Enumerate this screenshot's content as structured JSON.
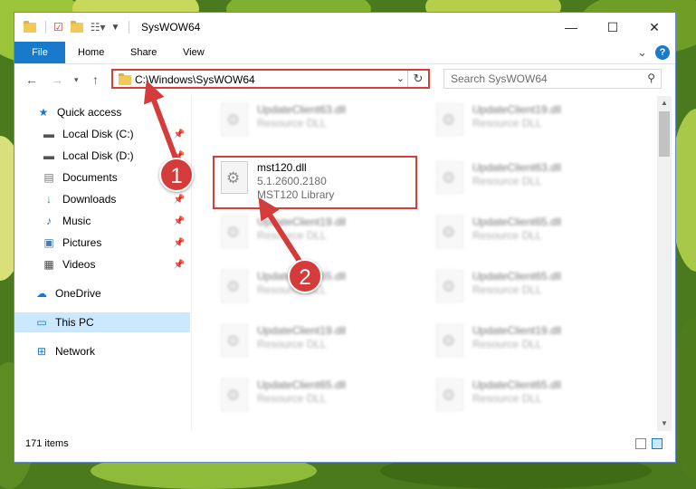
{
  "window": {
    "title": "SysWOW64",
    "minimize_icon": "minimize-icon",
    "maximize_icon": "maximize-icon",
    "close_icon": "close-icon"
  },
  "ribbon": {
    "tabs": [
      {
        "label": "File"
      },
      {
        "label": "Home"
      },
      {
        "label": "Share"
      },
      {
        "label": "View"
      }
    ],
    "help_icon": "?",
    "expand_icon": "⌄"
  },
  "address": {
    "path": "C:\\Windows\\SysWOW64",
    "search_placeholder": "Search SysWOW64"
  },
  "sidebar": {
    "items": [
      {
        "label": "Quick access",
        "icon": "★"
      },
      {
        "label": "Local Disk (C:)",
        "icon": "▬",
        "pinned": true
      },
      {
        "label": "Local Disk (D:)",
        "icon": "▬",
        "pinned": true
      },
      {
        "label": "Documents",
        "icon": "▤",
        "pinned": true
      },
      {
        "label": "Downloads",
        "icon": "↓",
        "pinned": true
      },
      {
        "label": "Music",
        "icon": "♪",
        "pinned": true
      },
      {
        "label": "Pictures",
        "icon": "▣",
        "pinned": true
      },
      {
        "label": "Videos",
        "icon": "▦",
        "pinned": true
      },
      {
        "label": "OneDrive",
        "icon": "☁"
      },
      {
        "label": "This PC",
        "icon": "▭"
      },
      {
        "label": "Network",
        "icon": "⊞"
      }
    ]
  },
  "files": {
    "highlighted": {
      "name": "mst120.dll",
      "version": "5.1.2600.2180",
      "description": "MST120 Library"
    },
    "left_col": [
      {
        "name": "UpdateClient63.dll",
        "type": "Resource DLL"
      },
      {
        "name": "UpdateClient19.dll",
        "type": "Resource DLL"
      },
      {
        "name": "UpdateClient65.dll",
        "type": "Resource DLL"
      },
      {
        "name": "UpdateClient19.dll",
        "type": "Resource DLL"
      },
      {
        "name": "UpdateClient65.dll",
        "type": "Resource DLL"
      }
    ],
    "right_col": [
      {
        "name": "UpdateClient19.dll",
        "type": "Resource DLL"
      },
      {
        "name": "UpdateClient63.dll",
        "type": "Resource DLL"
      },
      {
        "name": "UpdateClient65.dll",
        "type": "Resource DLL"
      },
      {
        "name": "UpdateClient65.dll",
        "type": "Resource DLL"
      },
      {
        "name": "UpdateClient19.dll",
        "type": "Resource DLL"
      },
      {
        "name": "UpdateClient65.dll",
        "type": "Resource DLL"
      }
    ]
  },
  "status": {
    "items_count": "171 items"
  },
  "annotations": {
    "step1": "1",
    "step2": "2"
  },
  "colors": {
    "accent": "#1979ca",
    "annotation_red": "#d43b3b"
  }
}
